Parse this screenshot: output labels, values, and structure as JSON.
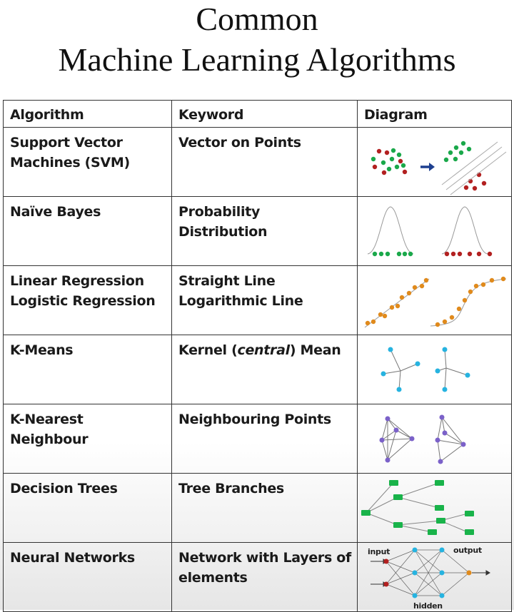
{
  "title": {
    "line1": "Common",
    "line2": "Machine Learning Algorithms"
  },
  "table": {
    "headers": [
      "Algorithm",
      "Keyword",
      "Diagram"
    ],
    "rows": [
      {
        "algorithm": [
          "Support Vector",
          "Machines (SVM)"
        ],
        "keyword": [
          "Vector on Points"
        ]
      },
      {
        "algorithm": [
          "Naïve Bayes"
        ],
        "keyword": [
          "Probability Distribution"
        ]
      },
      {
        "algorithm": [
          "Linear Regression",
          "Logistic Regression"
        ],
        "keyword": [
          "Straight Line",
          "Logarithmic Line"
        ]
      },
      {
        "algorithm": [
          "K-Means"
        ],
        "keyword_parts": [
          "Kernel (",
          "central",
          ") Mean"
        ]
      },
      {
        "algorithm": [
          "K-Nearest Neighbour"
        ],
        "keyword": [
          "Neighbouring Points"
        ]
      },
      {
        "algorithm": [
          "Decision Trees"
        ],
        "keyword": [
          "Tree Branches"
        ]
      },
      {
        "algorithm": [
          "Neural Networks"
        ],
        "keyword": [
          "Network with Layers of",
          "elements"
        ]
      }
    ]
  },
  "diagram_labels": {
    "input": "input",
    "output": "output",
    "hidden": "hidden"
  },
  "colors": {
    "red_dot": "#b22020",
    "green_dot": "#1aa84a",
    "arrow": "#1d3f8f",
    "orange_dot": "#e08a1c",
    "blue_dot": "#26b3e0",
    "purple_dot": "#7b61c9",
    "green_box": "#19b34a",
    "curve": "#999999"
  }
}
